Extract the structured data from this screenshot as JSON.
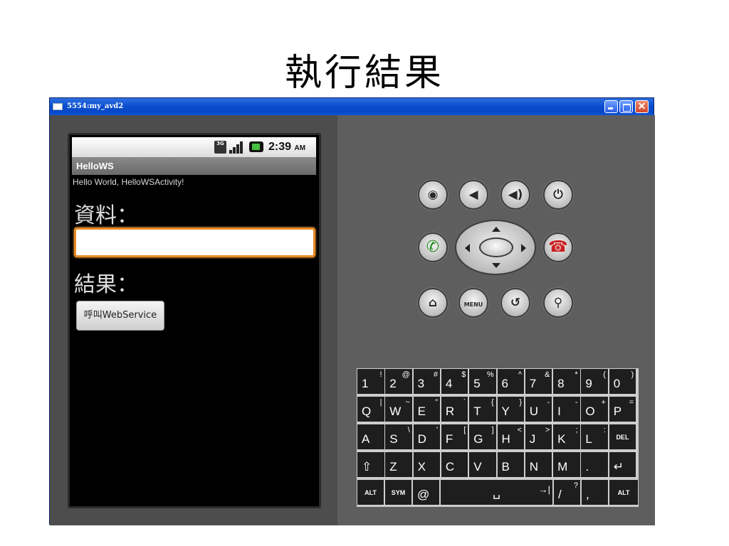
{
  "slide": {
    "title": "執行結果"
  },
  "window": {
    "title": "5554:my_avd2",
    "close_glyph": "✕"
  },
  "phone": {
    "status": {
      "network": "3G",
      "time": "2:39",
      "ampm": "AM"
    },
    "app_title": "HelloWS",
    "hello_text": "Hello World, HelloWSActivity!",
    "data_label": "資料：",
    "input_value": "",
    "result_label": "結果：",
    "button_label": "呼叫WebService"
  },
  "controls": {
    "camera": "◉",
    "vol_down": "◀",
    "vol_up": "◀)",
    "power": "⏻",
    "call": "✆",
    "end_call": "☎",
    "home": "⌂",
    "menu": "MENU",
    "back": "↺",
    "search": "⚲"
  },
  "keyboard": {
    "rows": [
      [
        {
          "k": "1",
          "s": "!"
        },
        {
          "k": "2",
          "s": "@"
        },
        {
          "k": "3",
          "s": "#"
        },
        {
          "k": "4",
          "s": "$"
        },
        {
          "k": "5",
          "s": "%"
        },
        {
          "k": "6",
          "s": "^"
        },
        {
          "k": "7",
          "s": "&"
        },
        {
          "k": "8",
          "s": "*"
        },
        {
          "k": "9",
          "s": "("
        },
        {
          "k": "0",
          "s": ")"
        }
      ],
      [
        {
          "k": "Q",
          "s": "|"
        },
        {
          "k": "W",
          "s": "~"
        },
        {
          "k": "E",
          "s": "\""
        },
        {
          "k": "R",
          "s": "`"
        },
        {
          "k": "T",
          "s": "{"
        },
        {
          "k": "Y",
          "s": "}"
        },
        {
          "k": "U",
          "s": "-"
        },
        {
          "k": "I",
          "s": "-"
        },
        {
          "k": "O",
          "s": "+"
        },
        {
          "k": "P",
          "s": "="
        }
      ],
      [
        {
          "k": "A",
          "s": ""
        },
        {
          "k": "S",
          "s": "\\"
        },
        {
          "k": "D",
          "s": "'"
        },
        {
          "k": "F",
          "s": "["
        },
        {
          "k": "G",
          "s": "]"
        },
        {
          "k": "H",
          "s": "<"
        },
        {
          "k": "J",
          "s": ">"
        },
        {
          "k": "K",
          "s": ";"
        },
        {
          "k": "L",
          "s": ":"
        },
        {
          "k": "DEL",
          "s": ""
        }
      ],
      [
        {
          "k": "⇧",
          "s": ""
        },
        {
          "k": "Z",
          "s": ""
        },
        {
          "k": "X",
          "s": ""
        },
        {
          "k": "C",
          "s": ""
        },
        {
          "k": "V",
          "s": ""
        },
        {
          "k": "B",
          "s": ""
        },
        {
          "k": "N",
          "s": ""
        },
        {
          "k": "M",
          "s": ""
        },
        {
          "k": ".",
          "s": ""
        },
        {
          "k": "↵",
          "s": ""
        }
      ]
    ],
    "bottom": {
      "alt_left": "ALT",
      "sym": "SYM",
      "at": "@",
      "space": "␣",
      "tab": "→|",
      "slash": "/",
      "slash_sub": "?",
      "comma": ",",
      "alt_right": "ALT"
    }
  }
}
